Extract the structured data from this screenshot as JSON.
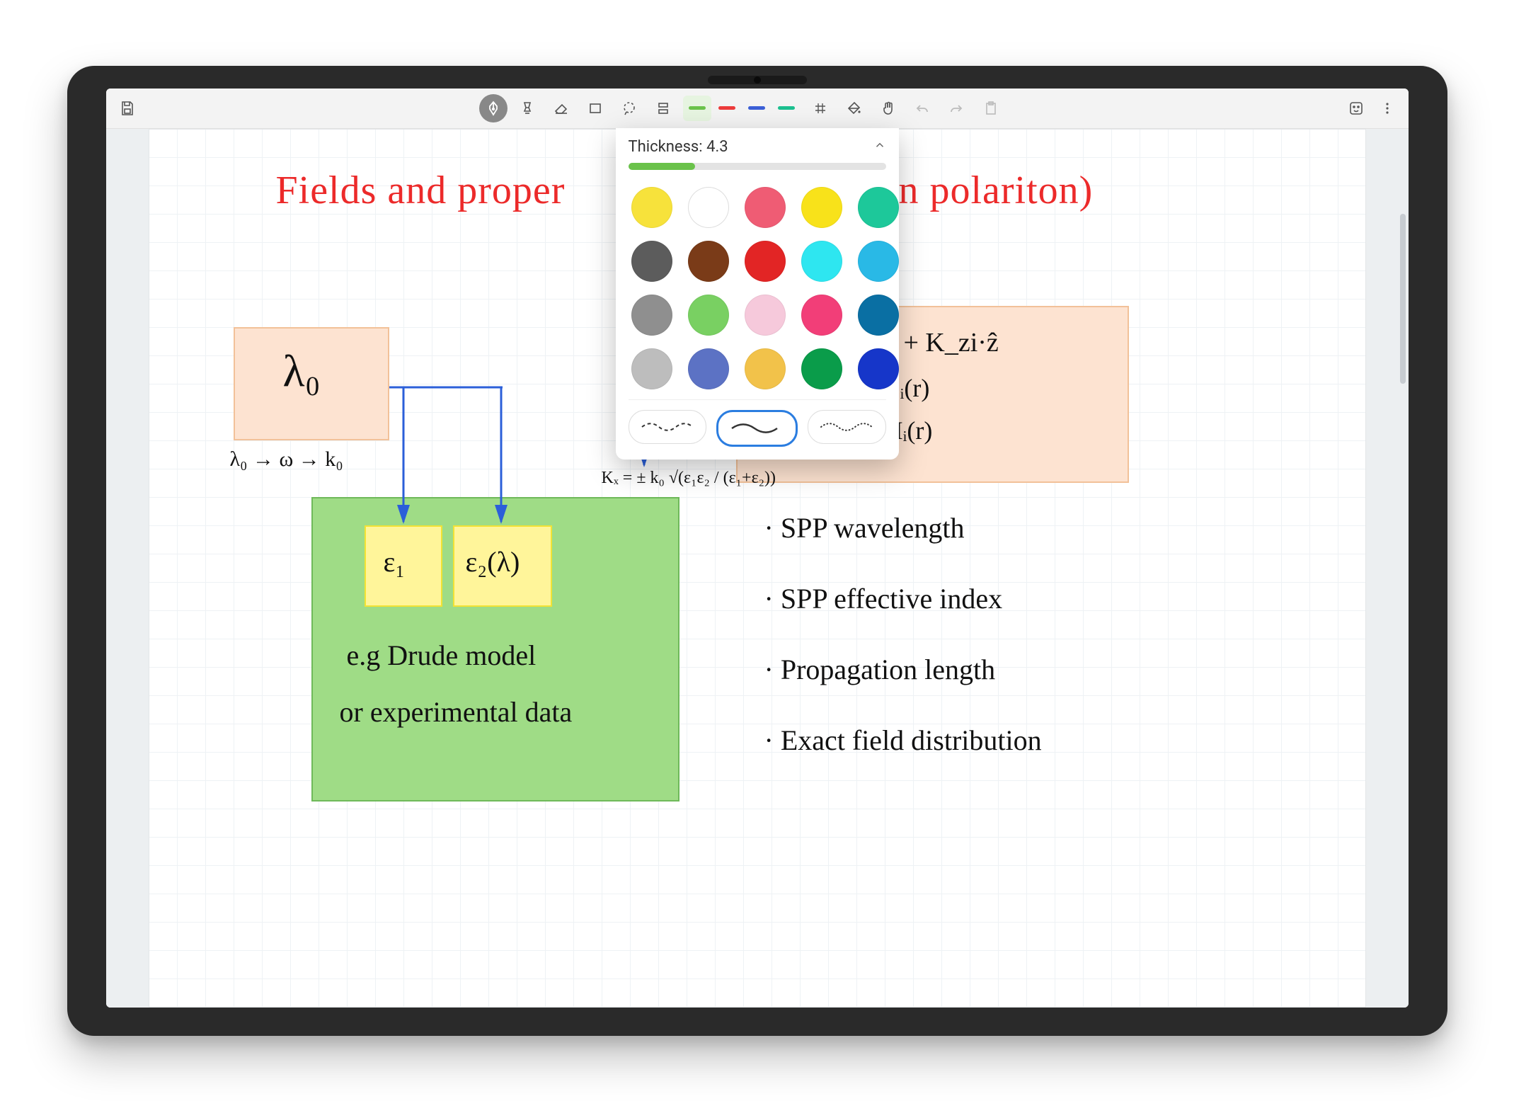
{
  "toolbar": {
    "colors": [
      {
        "hex": "#6ac24a",
        "selected": true
      },
      {
        "hex": "#ec3a3a",
        "selected": false
      },
      {
        "hex": "#3b5fd6",
        "selected": false
      },
      {
        "hex": "#1bbf8f",
        "selected": false
      }
    ]
  },
  "popup": {
    "label_prefix": "Thickness: ",
    "thickness": "4.3",
    "slider_percent": 26,
    "swatches": [
      "#f7e23b",
      "#ffffff",
      "#ef5c74",
      "#f8e21a",
      "#1dc89a",
      "#5c5c5c",
      "#7a3b18",
      "#e22525",
      "#2ee6f0",
      "#29b9e6",
      "#8f8f8f",
      "#79d062",
      "#f6c9db",
      "#f23e78",
      "#0a6fa3",
      "#bdbdbd",
      "#5c72c4",
      "#f2c24a",
      "#0a9c4a",
      "#1636c9"
    ],
    "stroke_styles": [
      "dashed",
      "solid",
      "dotted"
    ],
    "selected_stroke": 1
  },
  "notes": {
    "title_left": "Fields and proper",
    "title_right": "face plasmon polariton)",
    "lambda0": "λ₀",
    "lambda_chain": "λ₀ → ω → k₀",
    "eps1": "ε₁",
    "eps2": "ε₂(λ)",
    "drude1": "e.g  Drude model",
    "drude2": "or experimental data",
    "eq_k": "Kᵢ = Kₓˢᴾᴾ·x + K_zi·ẑ",
    "eq_e": "Eᵢ(r)",
    "eq_h": "Hᵢ(r)",
    "kx_formula": "Kₓ = ± k₀ √(ε₁ε₂ / (ε₁+ε₂))",
    "bullets": [
      "· SPP wavelength",
      "· SPP effective index",
      "· Propagation length",
      "· Exact field distribution"
    ]
  }
}
